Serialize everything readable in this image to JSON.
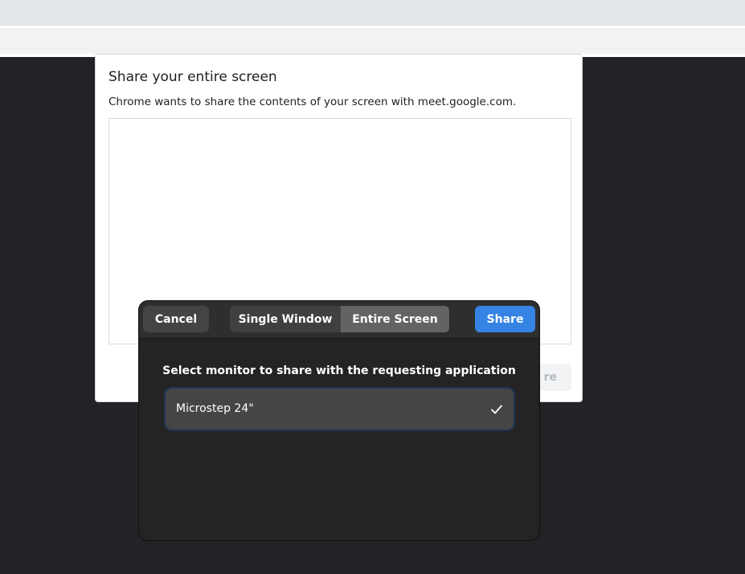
{
  "chrome_dialog": {
    "title": "Share your entire screen",
    "subtitle": "Chrome wants to share the contents of your screen with meet.google.com.",
    "share_label": "re"
  },
  "portal": {
    "cancel_label": "Cancel",
    "tabs": [
      {
        "label": "Single Window",
        "selected": false
      },
      {
        "label": "Entire Screen",
        "selected": true
      }
    ],
    "share_label": "Share",
    "heading": "Select monitor to share with the requesting application",
    "monitors": [
      {
        "label": "Microstep 24\"",
        "selected": true,
        "icon": "check-icon"
      }
    ]
  },
  "colors": {
    "accent": "#3584e4",
    "dialog_bg": "#242424",
    "background": "#222326"
  }
}
